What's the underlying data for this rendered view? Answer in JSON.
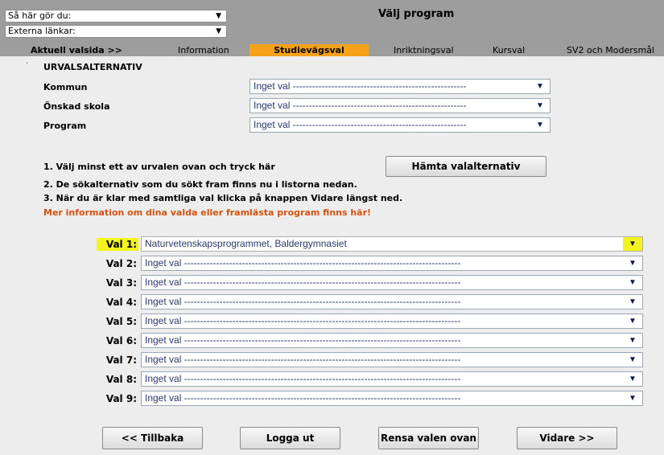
{
  "header": {
    "title": "Välj program",
    "help_select": "Så här gör du:",
    "links_select": "Externa länkar:"
  },
  "nav": {
    "current_page": "Aktuell valsida >>",
    "tabs": [
      {
        "label": "Information"
      },
      {
        "label": "Studievägsval",
        "active": true
      },
      {
        "label": "Inriktningsval"
      },
      {
        "label": "Kursval"
      },
      {
        "label": "SV2 och Modersmål"
      }
    ]
  },
  "filters": {
    "section_title": "URVALSALTERNATIV",
    "rows": [
      {
        "label": "Kommun",
        "value": "Inget val ------------------------------------------------------"
      },
      {
        "label": "Önskad skola",
        "value": "Inget val ------------------------------------------------------"
      },
      {
        "label": "Program",
        "value": "Inget val ------------------------------------------------------"
      }
    ]
  },
  "instructions": {
    "step1": "1. Välj minst ett av urvalen ovan och tryck här",
    "fetch_button": "Hämta valalternativ",
    "step2": "2. De sökalternativ som du sökt fram finns nu i listorna nedan.",
    "step3": "3. När du är klar med samtliga val klicka på knappen Vidare längst ned.",
    "info_link": "Mer information om dina valda eller framlästa program finns här!"
  },
  "choices": [
    {
      "label": "Val 1:",
      "value": "Naturvetenskapsprogrammet, Baldergymnasiet",
      "highlight": true
    },
    {
      "label": "Val 2:",
      "value": "Inget val --------------------------------------------------------------------------------------"
    },
    {
      "label": "Val 3:",
      "value": "Inget val --------------------------------------------------------------------------------------"
    },
    {
      "label": "Val 4:",
      "value": "Inget val --------------------------------------------------------------------------------------"
    },
    {
      "label": "Val 5:",
      "value": "Inget val --------------------------------------------------------------------------------------"
    },
    {
      "label": "Val 6:",
      "value": "Inget val --------------------------------------------------------------------------------------"
    },
    {
      "label": "Val 7:",
      "value": "Inget val --------------------------------------------------------------------------------------"
    },
    {
      "label": "Val 8:",
      "value": "Inget val --------------------------------------------------------------------------------------"
    },
    {
      "label": "Val 9:",
      "value": "Inget val --------------------------------------------------------------------------------------"
    }
  ],
  "buttons": {
    "back": "<< Tillbaka",
    "logout": "Logga ut",
    "clear": "Rensa valen ovan",
    "next": "Vidare >>"
  },
  "icons": {
    "dropdown": "▼"
  },
  "colors": {
    "active_tab": "#f5a11a",
    "highlight": "#f3f31d",
    "link": "#d35410",
    "topbar": "#9d9d9d"
  }
}
